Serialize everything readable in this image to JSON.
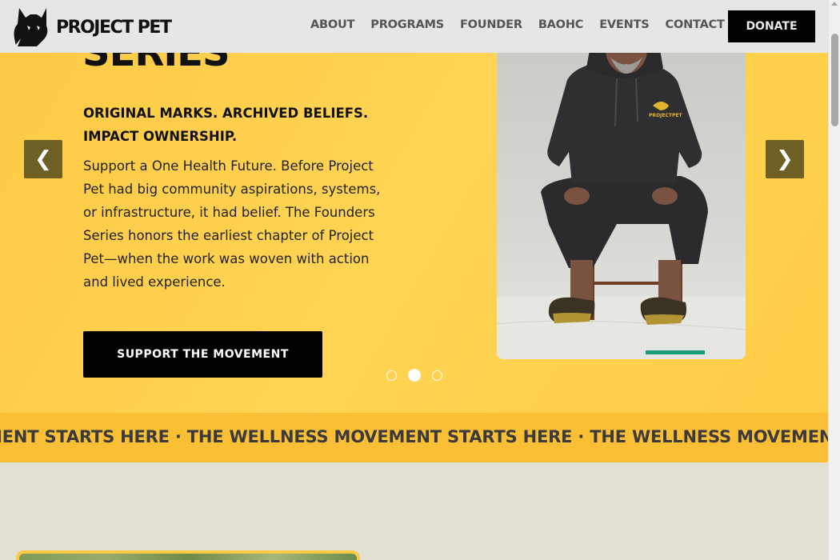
{
  "header": {
    "logo_text": "PROJECT PET",
    "nav": [
      "ABOUT",
      "PROGRAMS",
      "FOUNDER",
      "BAOHC",
      "EVENTS",
      "CONTACT"
    ],
    "donate_label": "DONATE"
  },
  "hero": {
    "title": "SERIES",
    "subtitle": "ORIGINAL MARKS. ARCHIVED BELIEFS. IMPACT OWNERSHIP.",
    "body": "Support a One Health Future. Before Project Pet had big community aspirations, systems, or infrastructure, it had belief. The Founders Series honors the earliest chapter of Project Pet—when the work was woven with action and lived experience.",
    "cta_label": "SUPPORT THE MOVEMENT",
    "prev_arrow": "❮",
    "next_arrow": "❯",
    "slide_count": 3,
    "active_slide": 2,
    "hoodie_logo": "PROJECTPET"
  },
  "marquee": {
    "text": "MENT STARTS HERE · THE WELLNESS MOVEMENT STARTS HERE · THE WELLNESS MOVEMENT STARTS HERE"
  },
  "colors": {
    "hero_yellow": "#ffd454",
    "marquee_yellow": "#fbbf36",
    "nav_gray": "#555555",
    "arrow_olive": "#6e5f24",
    "section_bg": "#e2dfd3"
  },
  "icons": [
    "logo-dog-icon",
    "chevron-left-icon",
    "chevron-right-icon"
  ]
}
